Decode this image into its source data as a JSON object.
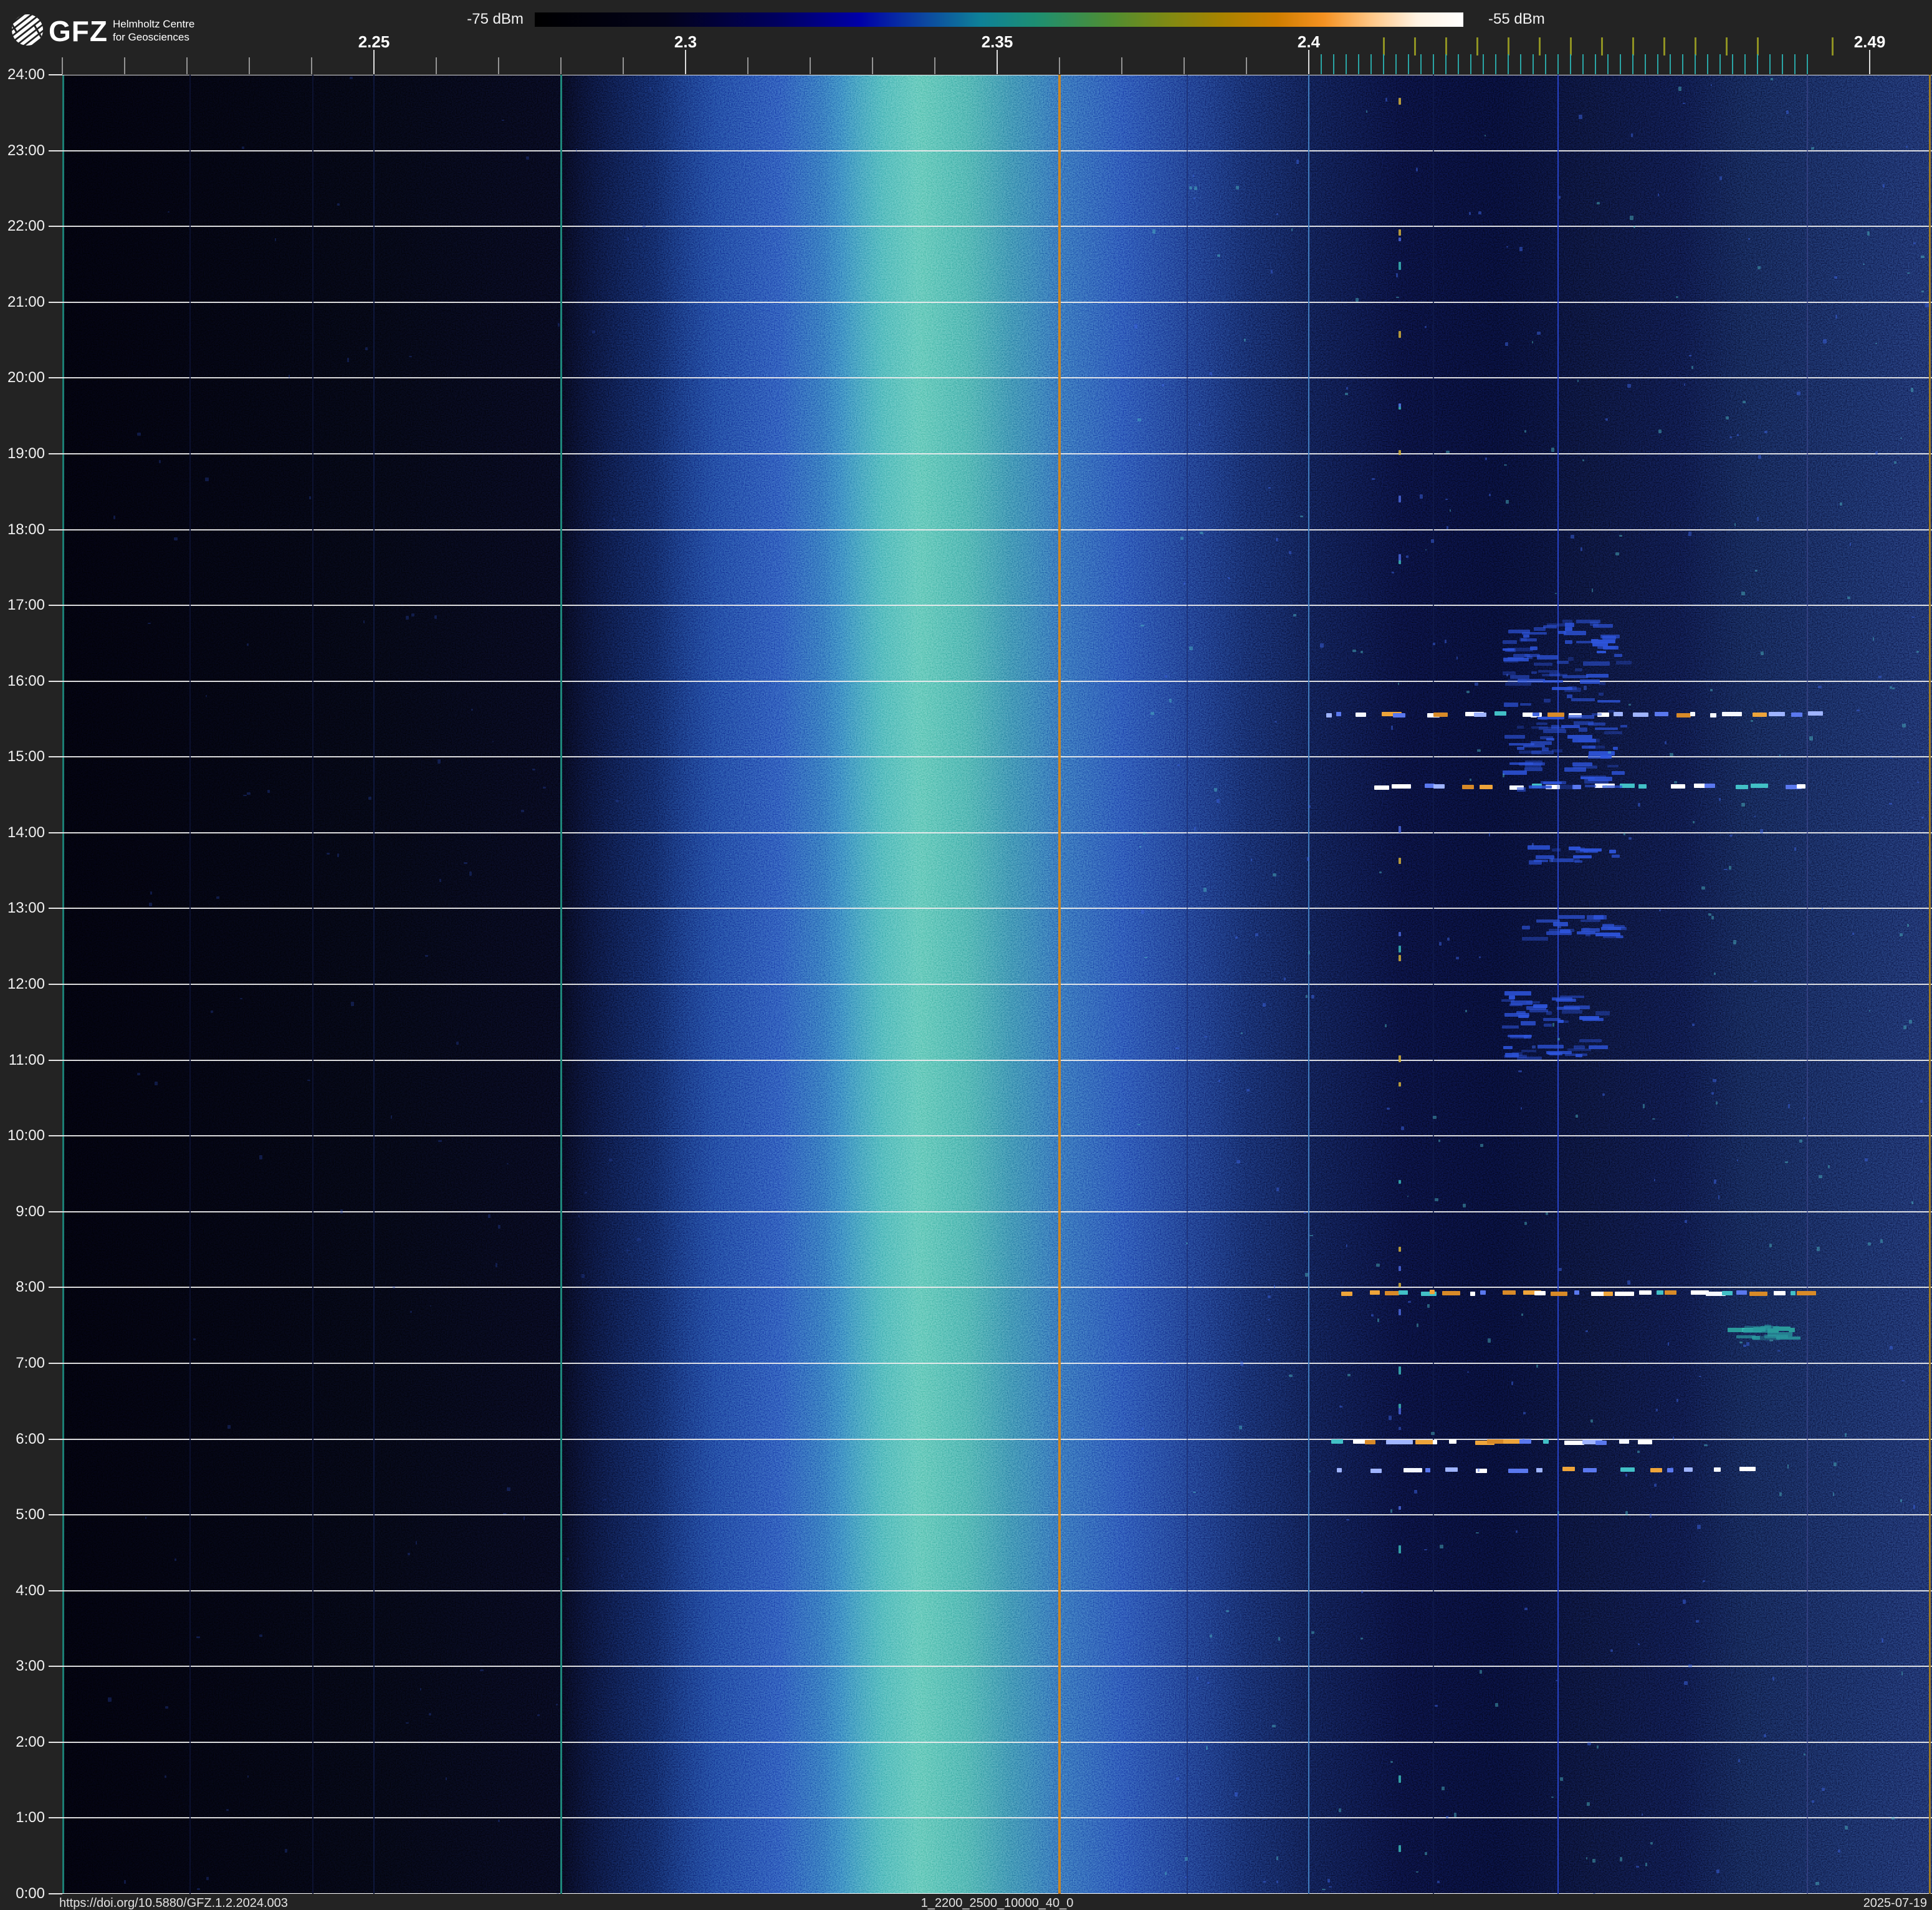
{
  "header": {
    "logo": {
      "brand": "GFZ",
      "line1": "Helmholtz Centre",
      "line2": "for Geosciences"
    },
    "colorbar": {
      "min_label": "-75 dBm",
      "max_label": "-55 dBm",
      "stops": [
        {
          "p": 0,
          "c": "#000000"
        },
        {
          "p": 14,
          "c": "#02021a"
        },
        {
          "p": 26,
          "c": "#00005e"
        },
        {
          "p": 35,
          "c": "#0000a8"
        },
        {
          "p": 42,
          "c": "#0c47a0"
        },
        {
          "p": 48,
          "c": "#0e8198"
        },
        {
          "p": 54,
          "c": "#1d8f72"
        },
        {
          "p": 62,
          "c": "#4f8e32"
        },
        {
          "p": 68,
          "c": "#7e8a14"
        },
        {
          "p": 74,
          "c": "#a88300"
        },
        {
          "p": 80,
          "c": "#d07e00"
        },
        {
          "p": 85,
          "c": "#f59222"
        },
        {
          "p": 90,
          "c": "#ffc685"
        },
        {
          "p": 95,
          "c": "#fff3e2"
        },
        {
          "p": 100,
          "c": "#ffffff"
        }
      ]
    }
  },
  "footer": {
    "doi": "https://doi.org/10.5880/GFZ.1.2.2024.003",
    "dataset": "1_2200_2500_10000_40_0",
    "date": "2025-07-19"
  },
  "chart_data": {
    "type": "heatmap",
    "title": "",
    "x_unit": "GHz",
    "x_range": [
      2.2,
      2.5
    ],
    "y_range_hours": [
      0,
      24
    ],
    "power_scale_dbm": [
      -75,
      -55
    ],
    "freq_axis": {
      "major_ticks": [
        {
          "f": 2.25,
          "label": "2.25"
        },
        {
          "f": 2.3,
          "label": "2.3"
        },
        {
          "f": 2.35,
          "label": "2.35"
        },
        {
          "f": 2.4,
          "label": "2.4"
        },
        {
          "f": 2.49,
          "label": "2.49"
        }
      ],
      "minor_ticks": [
        2.2,
        2.21,
        2.22,
        2.23,
        2.24,
        2.25,
        2.26,
        2.27,
        2.28,
        2.29,
        2.3,
        2.31,
        2.32,
        2.33,
        2.34,
        2.35,
        2.36,
        2.37,
        2.38,
        2.39,
        2.4,
        2.41,
        2.42,
        2.43,
        2.44,
        2.45,
        2.46,
        2.47,
        2.48,
        2.49
      ],
      "wifi_channel_ticks": [
        2.412,
        2.417,
        2.422,
        2.427,
        2.432,
        2.437,
        2.442,
        2.447,
        2.452,
        2.457,
        2.462,
        2.467,
        2.472,
        2.484
      ],
      "ble_channel_ticks": [
        2.402,
        2.404,
        2.406,
        2.408,
        2.41,
        2.412,
        2.414,
        2.416,
        2.418,
        2.42,
        2.422,
        2.424,
        2.426,
        2.428,
        2.43,
        2.432,
        2.434,
        2.436,
        2.438,
        2.44,
        2.442,
        2.444,
        2.446,
        2.448,
        2.45,
        2.452,
        2.454,
        2.456,
        2.458,
        2.46,
        2.462,
        2.464,
        2.466,
        2.468,
        2.47,
        2.472,
        2.474,
        2.476,
        2.478,
        2.48
      ]
    },
    "time_labels": [
      "24:00",
      "23:00",
      "22:00",
      "21:00",
      "20:00",
      "19:00",
      "18:00",
      "17:00",
      "16:00",
      "15:00",
      "14:00",
      "13:00",
      "12:00",
      "11:00",
      "10:00",
      "9:00",
      "8:00",
      "7:00",
      "6:00",
      "5:00",
      "4:00",
      "3:00",
      "2:00",
      "1:00",
      "0:00"
    ],
    "band_profile": [
      {
        "f": 2.2,
        "c": "#010106"
      },
      {
        "f": 2.25,
        "c": "#020309"
      },
      {
        "f": 2.28,
        "c": "#03040e"
      },
      {
        "f": 2.295,
        "c": "#081443"
      },
      {
        "f": 2.305,
        "c": "#102a80"
      },
      {
        "f": 2.315,
        "c": "#1738a0"
      },
      {
        "f": 2.325,
        "c": "#1d5ea6"
      },
      {
        "f": 2.332,
        "c": "#27858f"
      },
      {
        "f": 2.338,
        "c": "#2d9384"
      },
      {
        "f": 2.345,
        "c": "#2a8a88"
      },
      {
        "f": 2.352,
        "c": "#226f95"
      },
      {
        "f": 2.36,
        "c": "#1c4fa0"
      },
      {
        "f": 2.37,
        "c": "#16359b"
      },
      {
        "f": 2.38,
        "c": "#10246f"
      },
      {
        "f": 2.39,
        "c": "#0a1648"
      },
      {
        "f": 2.4,
        "c": "#070e30"
      },
      {
        "f": 2.415,
        "c": "#040720"
      },
      {
        "f": 2.43,
        "c": "#03061c"
      },
      {
        "f": 2.445,
        "c": "#05091f"
      },
      {
        "f": 2.46,
        "c": "#060b28"
      },
      {
        "f": 2.47,
        "c": "#091233"
      },
      {
        "f": 2.49,
        "c": "#0c1742"
      },
      {
        "f": 2.5,
        "c": "#0e1948"
      }
    ],
    "carriers": [
      {
        "f": 2.2205,
        "c": "#0c1232",
        "w": 2,
        "o": 0.9
      },
      {
        "f": 2.2402,
        "c": "#0d1434",
        "w": 2,
        "o": 0.9
      },
      {
        "f": 2.25,
        "c": "#101a40",
        "w": 2,
        "o": 0.9
      },
      {
        "f": 2.28,
        "c": "#1e877b",
        "w": 3,
        "o": 1
      },
      {
        "f": 2.36,
        "c": "#cc8522",
        "w": 3.5,
        "o": 1
      },
      {
        "f": 2.3805,
        "c": "#1a2a6a",
        "w": 1.5,
        "o": 0.6
      },
      {
        "f": 2.4,
        "c": "#4484c4",
        "w": 2,
        "o": 0.95
      },
      {
        "f": 2.42,
        "c": "#101a4a",
        "w": 1.5,
        "o": 0.8
      },
      {
        "f": 2.44,
        "c": "#2a44cc",
        "w": 2,
        "o": 0.95
      },
      {
        "f": 2.48,
        "c": "#3c4488",
        "w": 1.5,
        "o": 0.7
      },
      {
        "f": 2.4996,
        "c": "#a07c20",
        "w": 3,
        "o": 1
      }
    ],
    "events": {
      "palettes": {
        "wifi": [
          "#ffffff",
          "#ffffff",
          "#f5f8ff",
          "#eea43a",
          "#d88a28",
          "#42c0c6",
          "#5a78ee",
          "#9fb4ff"
        ],
        "teal": [
          "#35b6ae",
          "#2a9a9a",
          "#58c8c0"
        ]
      },
      "dash_rows": [
        {
          "time": "15:34",
          "f_start": 2.401,
          "f_end": 2.481,
          "count": 26,
          "palette": "wifi"
        },
        {
          "time": "14:37",
          "f_start": 2.409,
          "f_end": 2.481,
          "count": 20,
          "palette": "wifi"
        },
        {
          "time": "7:56",
          "f_start": 2.405,
          "f_end": 2.481,
          "count": 28,
          "palette": "wifi"
        },
        {
          "time": "7:27",
          "f_start": 2.467,
          "f_end": 2.478,
          "count": 6,
          "palette": "teal"
        },
        {
          "time": "5:58",
          "f_start": 2.402,
          "f_end": 2.454,
          "count": 18,
          "palette": "wifi"
        },
        {
          "time": "5:36",
          "f_start": 2.404,
          "f_end": 2.473,
          "count": 16,
          "palette": "wifi"
        }
      ],
      "plumes": [
        {
          "time_start": "16:50",
          "time_end": "14:35",
          "f_start": 2.431,
          "f_end": 2.452,
          "count": 130,
          "color": "#2e55dd"
        },
        {
          "time_start": "13:51",
          "time_end": "13:38",
          "f_start": 2.434,
          "f_end": 2.45,
          "count": 16,
          "color": "#2e55dd"
        },
        {
          "time_start": "12:56",
          "time_end": "12:37",
          "f_start": 2.433,
          "f_end": 2.451,
          "count": 22,
          "color": "#2e55dd"
        },
        {
          "time_start": "11:56",
          "time_end": "11:02",
          "f_start": 2.43,
          "f_end": 2.449,
          "count": 48,
          "color": "#2e55dd"
        },
        {
          "time_start": "7:31",
          "time_end": "7:21",
          "f_start": 2.466,
          "f_end": 2.479,
          "count": 10,
          "color": "#2a9aa0"
        }
      ],
      "beacon_column": {
        "f": 2.4146,
        "count": 30,
        "palette": [
          "#d4b23a",
          "#3ab6b6",
          "#4a66d8"
        ]
      },
      "speckle": [
        {
          "f_start": 2.372,
          "f_end": 2.5,
          "count": 420,
          "colors": [
            "rgba(60,100,225,0.5)",
            "rgba(80,190,200,0.45)"
          ]
        },
        {
          "f_start": 2.205,
          "f_end": 2.295,
          "count": 110,
          "colors": [
            "rgba(40,70,170,0.35)"
          ]
        }
      ]
    }
  }
}
